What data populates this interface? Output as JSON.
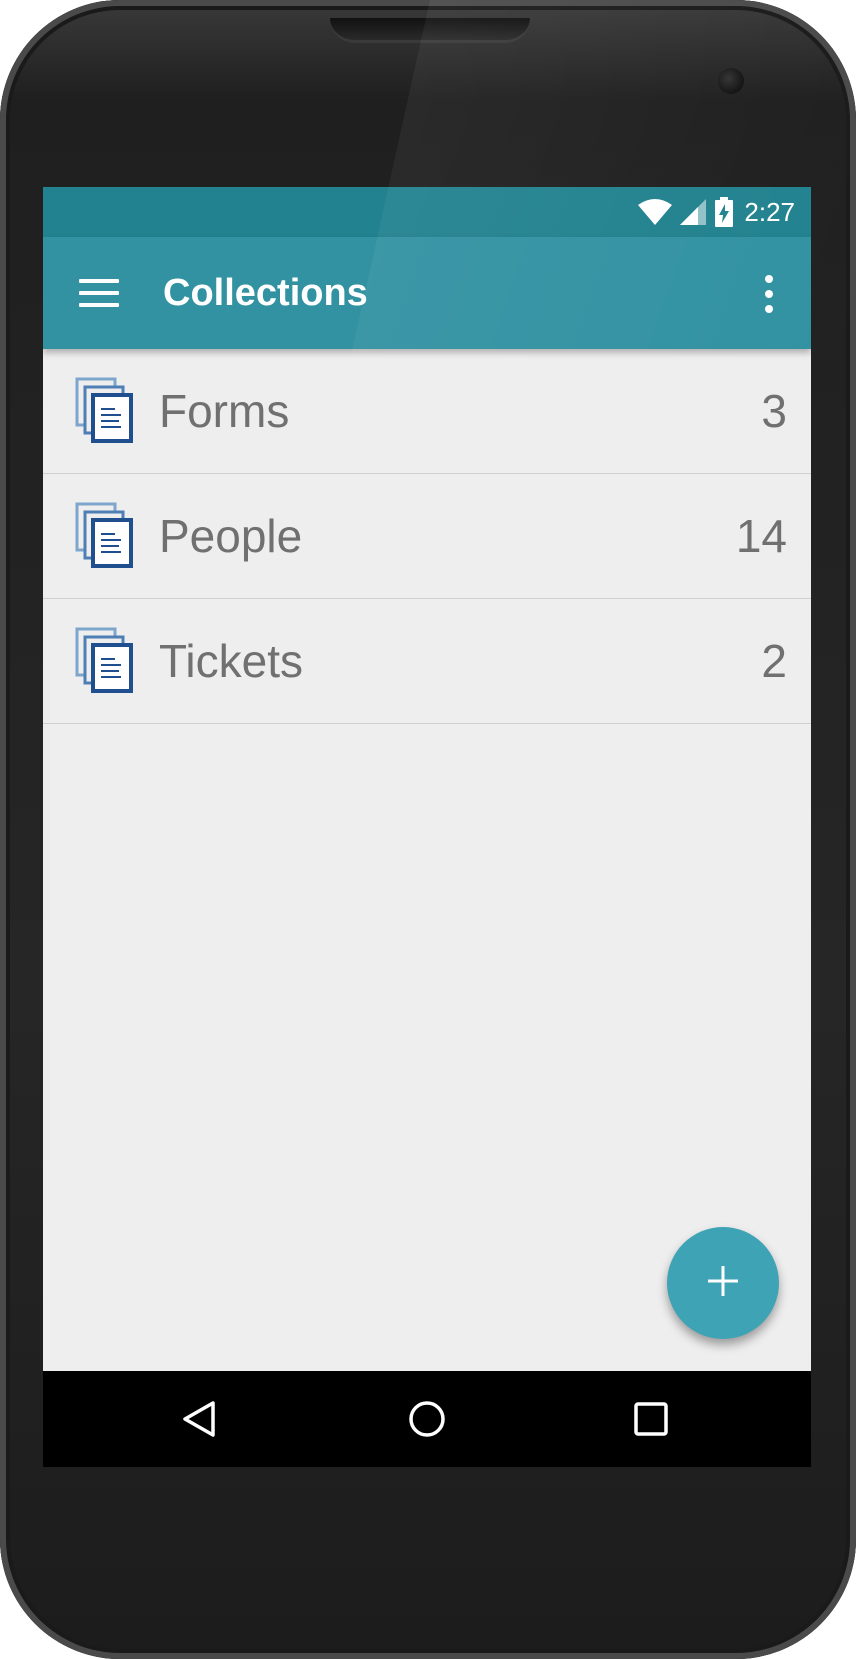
{
  "status_bar": {
    "time": "2:27",
    "icons": [
      "wifi-icon",
      "signal-icon",
      "battery-charging-icon"
    ]
  },
  "app_bar": {
    "title": "Collections",
    "nav_icon": "hamburger-menu-icon",
    "action_icon": "overflow-menu-icon"
  },
  "collections": [
    {
      "label": "Forms",
      "count": "3",
      "icon": "collection-documents-icon"
    },
    {
      "label": "People",
      "count": "14",
      "icon": "collection-documents-icon"
    },
    {
      "label": "Tickets",
      "count": "2",
      "icon": "collection-documents-icon"
    }
  ],
  "fab": {
    "icon": "plus-icon",
    "symbol": "+"
  },
  "nav_bar": {
    "icons": [
      "back-icon",
      "home-icon",
      "recents-icon"
    ]
  },
  "colors": {
    "status_bar": "#22828f",
    "app_bar": "#3292a2",
    "fab": "#3ea3b4",
    "list_background": "#eeeeee",
    "list_text": "#707070"
  }
}
